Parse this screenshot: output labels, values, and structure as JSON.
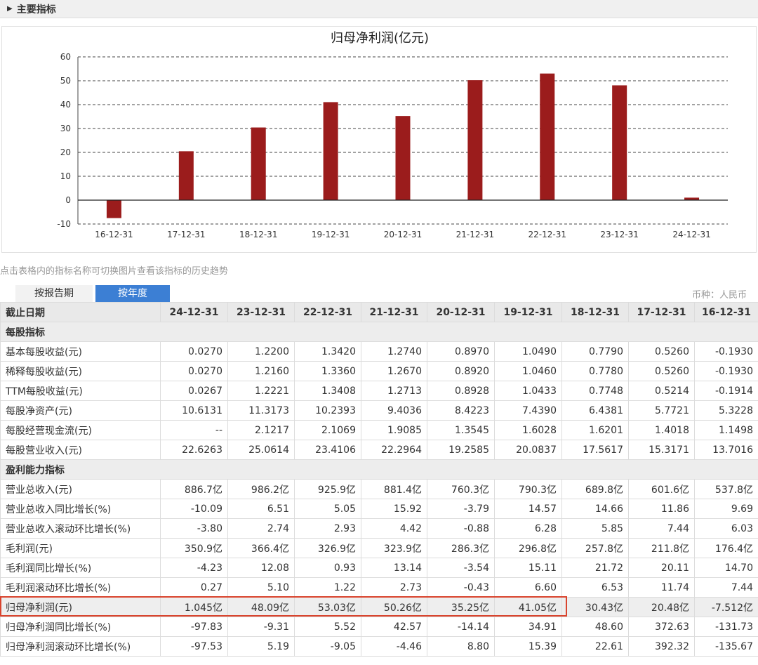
{
  "header": {
    "title": "主要指标"
  },
  "chart_data": {
    "type": "bar",
    "title": "归母净利润(亿元)",
    "categories": [
      "16-12-31",
      "17-12-31",
      "18-12-31",
      "19-12-31",
      "20-12-31",
      "21-12-31",
      "22-12-31",
      "23-12-31",
      "24-12-31"
    ],
    "values": [
      -7.512,
      20.48,
      30.43,
      41.05,
      35.25,
      50.26,
      53.03,
      48.09,
      1.045
    ],
    "ylim": [
      -10,
      60
    ],
    "yticks": [
      "60",
      "50",
      "40",
      "30",
      "20",
      "10",
      "0",
      "-10"
    ],
    "grid": true,
    "bar_color": "#9b1c1c"
  },
  "hint": "点击表格内的指标名称可切换图片查看该指标的历史趋势",
  "tabs": {
    "report": "按报告期",
    "year": "按年度"
  },
  "currency": "币种：人民币",
  "table": {
    "corner": "截止日期",
    "columns": [
      "24-12-31",
      "23-12-31",
      "22-12-31",
      "21-12-31",
      "20-12-31",
      "19-12-31",
      "18-12-31",
      "17-12-31",
      "16-12-31"
    ],
    "groups": [
      {
        "title": "每股指标",
        "rows": [
          {
            "name": "基本每股收益(元)",
            "values": [
              "0.0270",
              "1.2200",
              "1.3420",
              "1.2740",
              "0.8970",
              "1.0490",
              "0.7790",
              "0.5260",
              "-0.1930"
            ]
          },
          {
            "name": "稀释每股收益(元)",
            "values": [
              "0.0270",
              "1.2160",
              "1.3360",
              "1.2670",
              "0.8920",
              "1.0460",
              "0.7780",
              "0.5260",
              "-0.1930"
            ]
          },
          {
            "name": "TTM每股收益(元)",
            "values": [
              "0.0267",
              "1.2221",
              "1.3408",
              "1.2713",
              "0.8928",
              "1.0433",
              "0.7748",
              "0.5214",
              "-0.1914"
            ]
          },
          {
            "name": "每股净资产(元)",
            "values": [
              "10.6131",
              "11.3173",
              "10.2393",
              "9.4036",
              "8.4223",
              "7.4390",
              "6.4381",
              "5.7721",
              "5.3228"
            ]
          },
          {
            "name": "每股经营现金流(元)",
            "values": [
              "--",
              "2.1217",
              "2.1069",
              "1.9085",
              "1.3545",
              "1.6028",
              "1.6201",
              "1.4018",
              "1.1498"
            ]
          },
          {
            "name": "每股营业收入(元)",
            "values": [
              "22.6263",
              "25.0614",
              "23.4106",
              "22.2964",
              "19.2585",
              "20.0837",
              "17.5617",
              "15.3171",
              "13.7016"
            ]
          }
        ]
      },
      {
        "title": "盈利能力指标",
        "rows": [
          {
            "name": "营业总收入(元)",
            "values": [
              "886.7亿",
              "986.2亿",
              "925.9亿",
              "881.4亿",
              "760.3亿",
              "790.3亿",
              "689.8亿",
              "601.6亿",
              "537.8亿"
            ]
          },
          {
            "name": "营业总收入同比增长(%)",
            "values": [
              "-10.09",
              "6.51",
              "5.05",
              "15.92",
              "-3.79",
              "14.57",
              "14.66",
              "11.86",
              "9.69"
            ]
          },
          {
            "name": "营业总收入滚动环比增长(%)",
            "values": [
              "-3.80",
              "2.74",
              "2.93",
              "4.42",
              "-0.88",
              "6.28",
              "5.85",
              "7.44",
              "6.03"
            ]
          },
          {
            "name": "毛利润(元)",
            "values": [
              "350.9亿",
              "366.4亿",
              "326.9亿",
              "323.9亿",
              "286.3亿",
              "296.8亿",
              "257.8亿",
              "211.8亿",
              "176.4亿"
            ]
          },
          {
            "name": "毛利润同比增长(%)",
            "values": [
              "-4.23",
              "12.08",
              "0.93",
              "13.14",
              "-3.54",
              "15.11",
              "21.72",
              "20.11",
              "14.70"
            ]
          },
          {
            "name": "毛利润滚动环比增长(%)",
            "values": [
              "0.27",
              "5.10",
              "1.22",
              "2.73",
              "-0.43",
              "6.60",
              "6.53",
              "11.74",
              "7.44"
            ]
          },
          {
            "name": "归母净利润(元)",
            "highlight": true,
            "values": [
              "1.045亿",
              "48.09亿",
              "53.03亿",
              "50.26亿",
              "35.25亿",
              "41.05亿",
              "30.43亿",
              "20.48亿",
              "-7.512亿"
            ]
          },
          {
            "name": "归母净利润同比增长(%)",
            "values": [
              "-97.83",
              "-9.31",
              "5.52",
              "42.57",
              "-14.14",
              "34.91",
              "48.60",
              "372.63",
              "-131.73"
            ]
          },
          {
            "name": "归母净利润滚动环比增长(%)",
            "values": [
              "-97.53",
              "5.19",
              "-9.05",
              "-4.46",
              "8.80",
              "15.39",
              "22.61",
              "392.32",
              "-135.67"
            ]
          }
        ]
      }
    ]
  },
  "colors": {
    "tab_active": "#3c7fd4",
    "highlight_border": "#d9442e"
  }
}
